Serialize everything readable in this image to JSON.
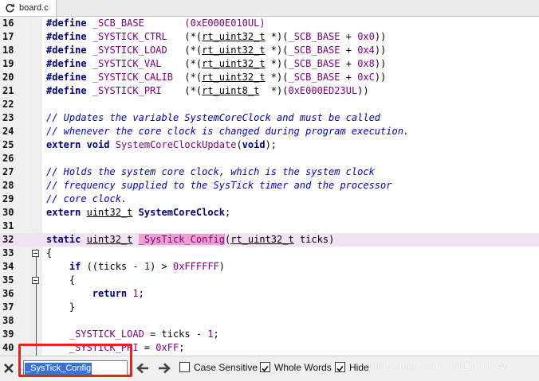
{
  "tab": {
    "label": "board.c"
  },
  "editor": {
    "lines": [
      {
        "n": "16",
        "html": "<span class=\"kw\">#define</span> <span class=\"mac\">_SCB_BASE</span>       <span class=\"num\">(0xE000E010UL)</span>"
      },
      {
        "n": "17",
        "html": "<span class=\"kw\">#define</span> <span class=\"mac\">_SYSTICK_CTRL</span>   (*(<span class=\"u\">rt_uint32_t</span> *)(<span class=\"mac\">_SCB_BASE</span> + <span class=\"num\">0x0</span>))"
      },
      {
        "n": "18",
        "html": "<span class=\"kw\">#define</span> <span class=\"mac\">_SYSTICK_LOAD</span>   (*(<span class=\"u\">rt_uint32_t</span> *)(<span class=\"mac\">_SCB_BASE</span> + <span class=\"num\">0x4</span>))"
      },
      {
        "n": "19",
        "html": "<span class=\"kw\">#define</span> <span class=\"mac\">_SYSTICK_VAL</span>    (*(<span class=\"u\">rt_uint32_t</span> *)(<span class=\"mac\">_SCB_BASE</span> + <span class=\"num\">0x8</span>))"
      },
      {
        "n": "20",
        "html": "<span class=\"kw\">#define</span> <span class=\"mac\">_SYSTICK_CALIB</span>  (*(<span class=\"u\">rt_uint32_t</span> *)(<span class=\"mac\">_SCB_BASE</span> + <span class=\"num\">0xC</span>))"
      },
      {
        "n": "21",
        "html": "<span class=\"kw\">#define</span> <span class=\"mac\">_SYSTICK_PRI</span>    (*(<span class=\"u\">rt_uint8_t</span>  *)(<span class=\"num\">0xE000ED23UL</span>))"
      },
      {
        "n": "22",
        "html": ""
      },
      {
        "n": "23",
        "html": "<span class=\"cm\">// Updates the variable SystemCoreClock and must be called</span>"
      },
      {
        "n": "24",
        "html": "<span class=\"cm\">// whenever the core clock is changed during program execution.</span>"
      },
      {
        "n": "25",
        "html": "<span class=\"kw\">extern void</span> <span class=\"mac\">SystemCoreClockUpdate</span>(<span class=\"kw\">void</span>);"
      },
      {
        "n": "26",
        "html": ""
      },
      {
        "n": "27",
        "html": "<span class=\"cm\">// Holds the system core clock, which is the system clock</span>"
      },
      {
        "n": "28",
        "html": "<span class=\"cm\">// frequency supplied to the SysTick timer and the processor</span>"
      },
      {
        "n": "29",
        "html": "<span class=\"cm\">// core clock.</span>"
      },
      {
        "n": "30",
        "html": "<span class=\"kw\">extern</span> <span class=\"u\">uint32_t</span> <span class=\"kw\">SystemCoreClock</span>;"
      },
      {
        "n": "31",
        "html": ""
      },
      {
        "n": "32",
        "html": "<span class=\"kw\">static</span> <span class=\"u\">uint32_t</span> <span class=\"sel mac\">_SysTick_Config</span>(<span class=\"u\">rt_uint32_t</span> ticks)",
        "hl": true
      },
      {
        "n": "33",
        "html": "{"
      },
      {
        "n": "34",
        "html": "    <span class=\"kw\">if</span> ((ticks - <span class=\"num\">1</span>) > <span class=\"num\">0xFFFFFF</span>)"
      },
      {
        "n": "35",
        "html": "    {"
      },
      {
        "n": "36",
        "html": "        <span class=\"kw\">return</span> <span class=\"num\">1</span>;"
      },
      {
        "n": "37",
        "html": "    }"
      },
      {
        "n": "38",
        "html": ""
      },
      {
        "n": "39",
        "html": "    <span class=\"mac\">_SYSTICK_LOAD</span> = ticks - <span class=\"num\">1</span>;"
      },
      {
        "n": "40",
        "html": "    <span class=\"mac\">_SYSTICK_PRI</span> = <span class=\"num\">0xFF</span>;"
      }
    ]
  },
  "findbar": {
    "query": "_SysTick_Config",
    "case_sensitive_label": "Case Sensitive",
    "case_sensitive": false,
    "whole_words_label": "Whole Words",
    "whole_words": true,
    "hide_label": "Hide",
    "hide": true
  },
  "watermark": "https://blog.csdn.net/Davidysw",
  "colors": {
    "highlight_row": "#efe3ef",
    "selection": "#f0a0d0",
    "annotation_box": "#e8231c"
  }
}
